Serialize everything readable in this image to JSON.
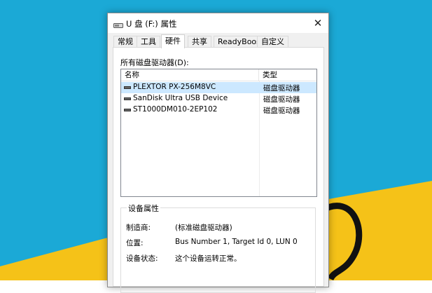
{
  "window": {
    "title": "U 盘 (F:) 属性",
    "close_symbol": "✕",
    "icon": "drive-icon"
  },
  "tabs": [
    {
      "label": "常规",
      "active": false
    },
    {
      "label": "工具",
      "active": false
    },
    {
      "label": "硬件",
      "active": true
    },
    {
      "label": "共享",
      "active": false
    },
    {
      "label": "ReadyBoost",
      "active": false
    },
    {
      "label": "自定义",
      "active": false
    }
  ],
  "hardware": {
    "drives_label": "所有磁盘驱动器(D):",
    "columns": {
      "name": "名称",
      "type": "类型"
    },
    "drives": [
      {
        "name": "PLEXTOR PX-256M8VC",
        "type": "磁盘驱动器",
        "selected": true
      },
      {
        "name": "SanDisk Ultra USB Device",
        "type": "磁盘驱动器",
        "selected": false
      },
      {
        "name": "ST1000DM010-2EP102",
        "type": "磁盘驱动器",
        "selected": false
      }
    ],
    "properties": {
      "title": "设备属性",
      "manufacturer_label": "制造商:",
      "manufacturer_value": "(标准磁盘驱动器)",
      "location_label": "位置:",
      "location_value": "Bus Number 1, Target Id 0, LUN 0",
      "status_label": "设备状态:",
      "status_value": "这个设备运转正常。"
    }
  },
  "colors": {
    "wallpaper_blue": "#1ba9d6",
    "wallpaper_yellow": "#f5c218",
    "selection": "#cce8ff"
  }
}
